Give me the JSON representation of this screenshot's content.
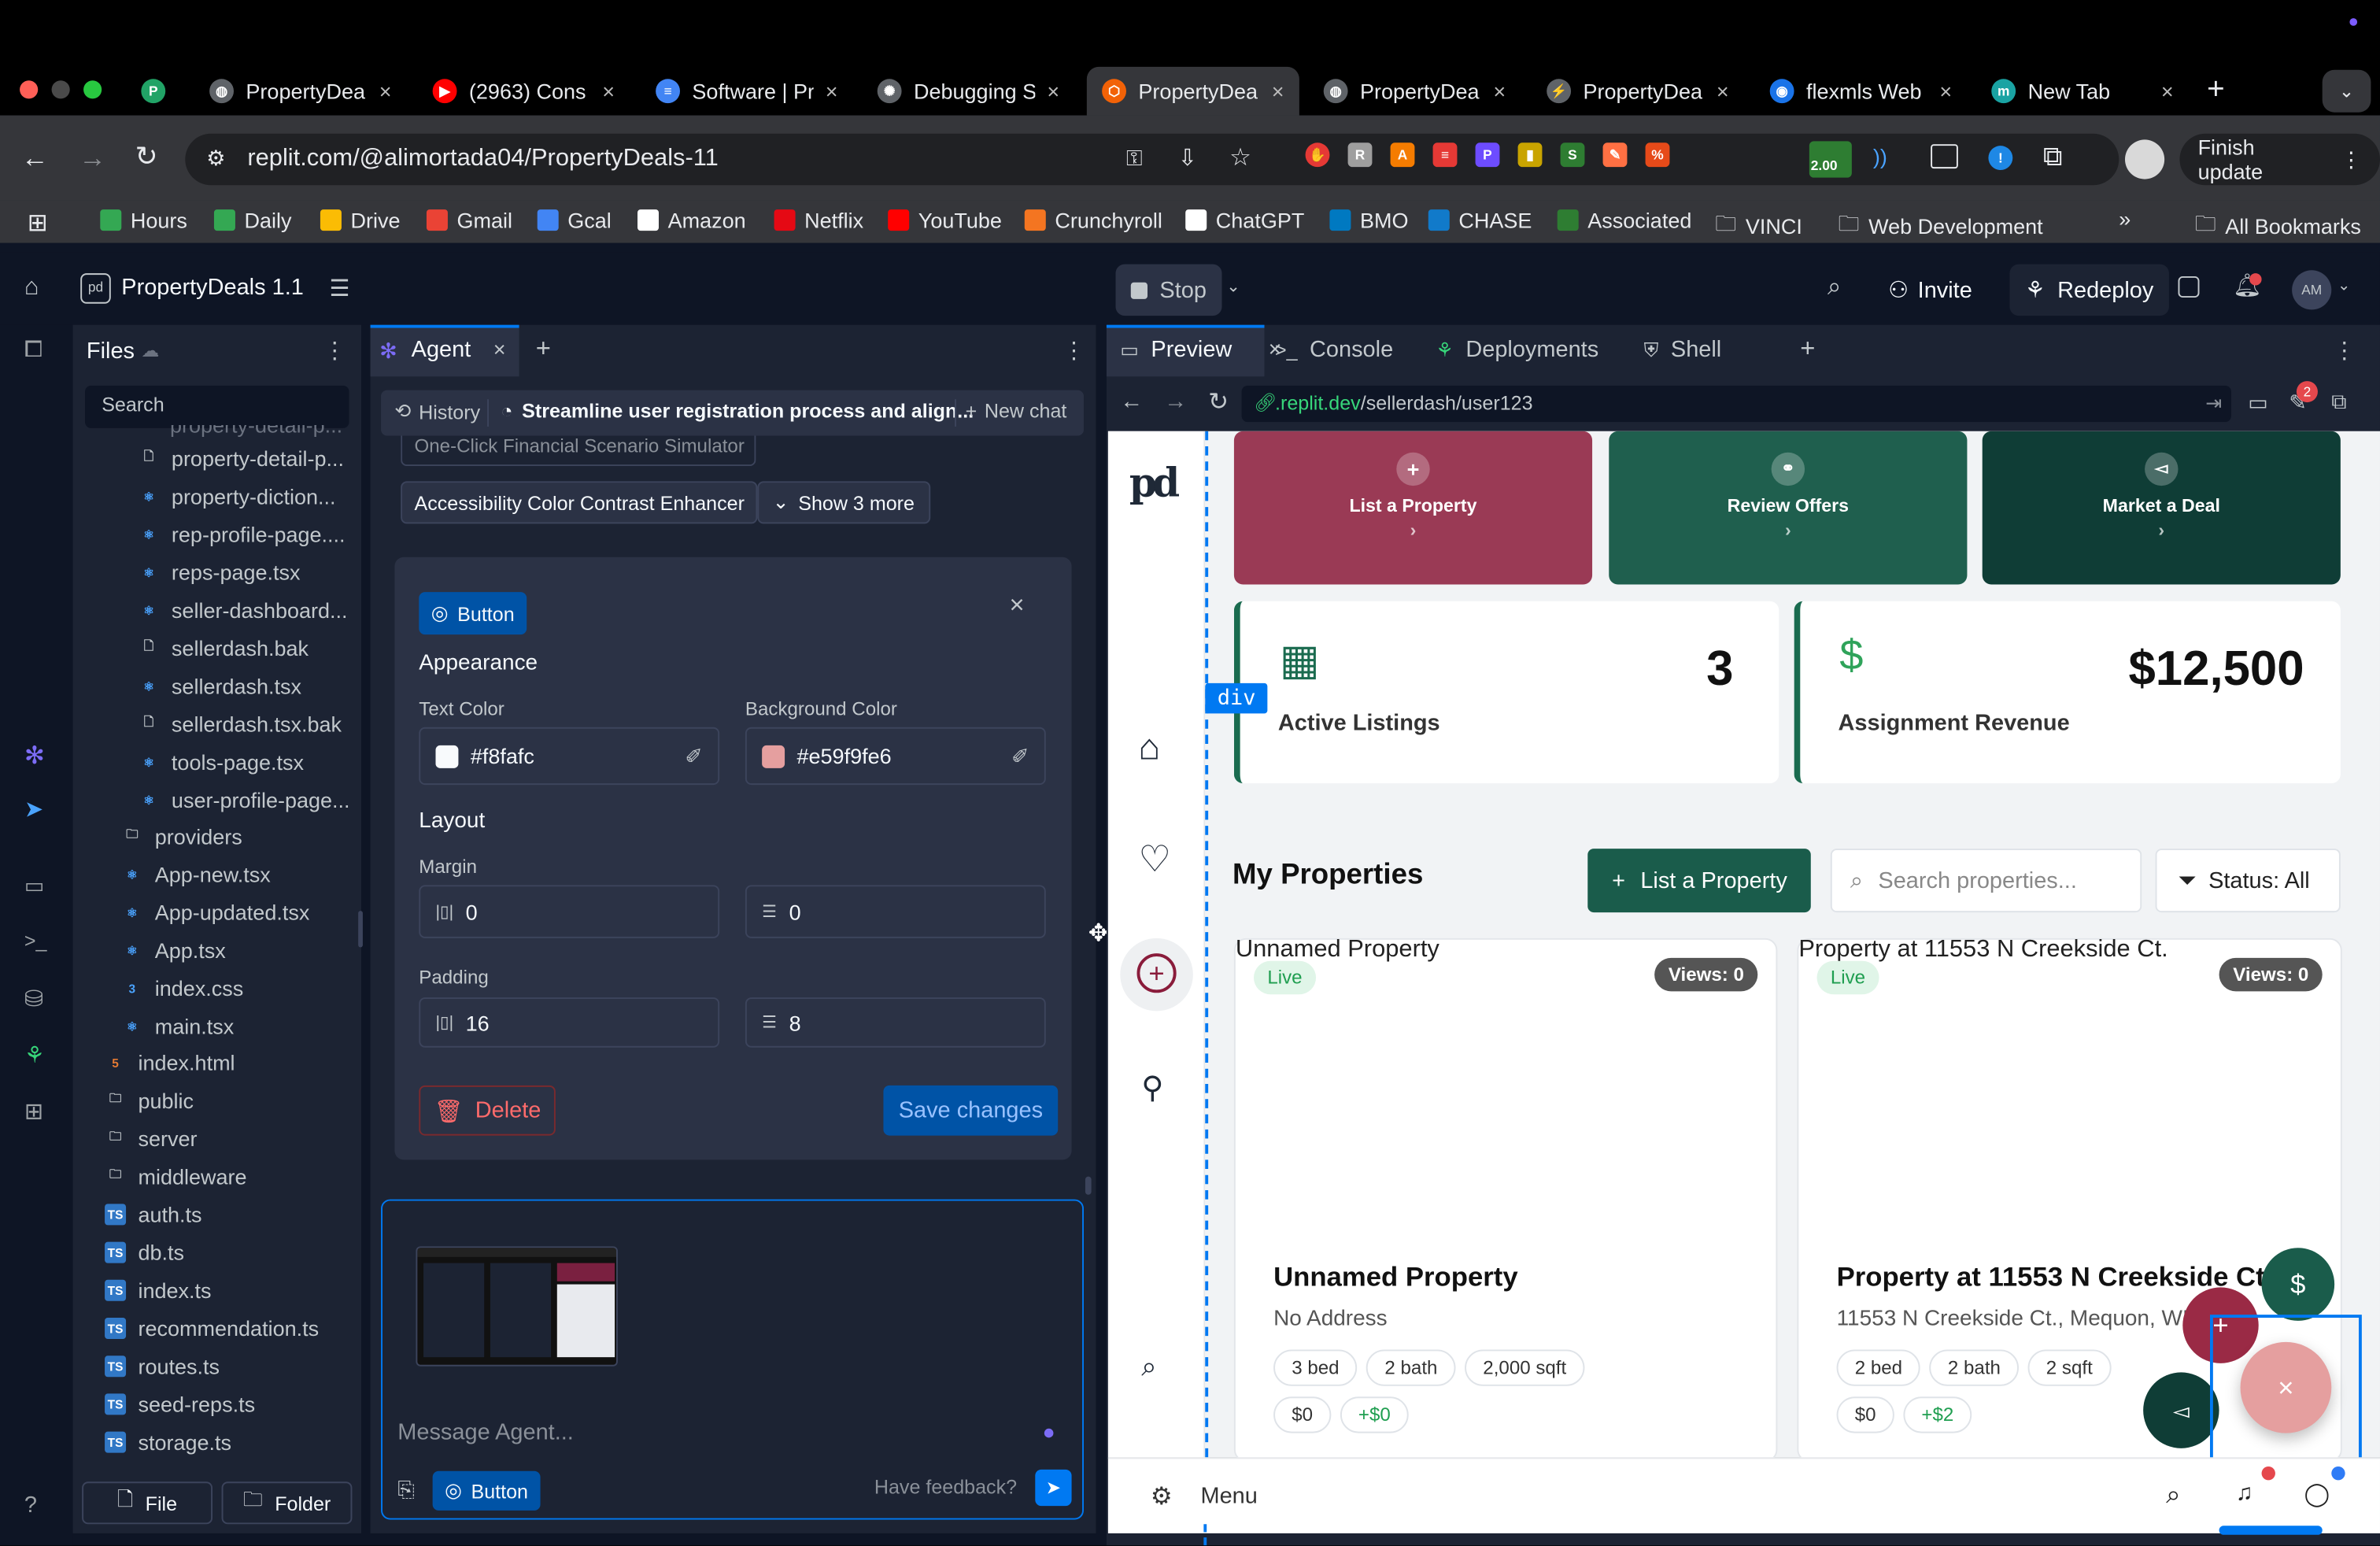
{
  "browser": {
    "tabs": [
      {
        "title": "PropertyDea",
        "icon": "globe-icon"
      },
      {
        "title": "(2963) Cons",
        "icon": "youtube-icon"
      },
      {
        "title": "Software | Pr",
        "icon": "docs-icon"
      },
      {
        "title": "Debugging S",
        "icon": "openai-icon"
      },
      {
        "title": "PropertyDea",
        "icon": "replit-icon"
      },
      {
        "title": "PropertyDea",
        "icon": "globe-icon"
      },
      {
        "title": "PropertyDea",
        "icon": "bolt-icon"
      },
      {
        "title": "flexmls Web",
        "icon": "flexmls-icon"
      },
      {
        "title": "New Tab",
        "icon": "m-icon"
      }
    ],
    "url": "replit.com/@alimortada04/PropertyDeals-11",
    "finish_update": "Finish update",
    "ext_badge": "2.00",
    "bookmarks": [
      "Hours",
      "Daily",
      "Drive",
      "Gmail",
      "Gcal",
      "Amazon",
      "Netflix",
      "YouTube",
      "Crunchyroll",
      "ChatGPT",
      "BMO",
      "CHASE",
      "Associated",
      "VINCI",
      "Web Development"
    ],
    "all_bookmarks": "All Bookmarks"
  },
  "replit": {
    "project": "PropertyDeals 1.1",
    "stop": "Stop",
    "invite": "Invite",
    "redeploy": "Redeploy",
    "avatar": "AM"
  },
  "files": {
    "title": "Files",
    "search": "Search",
    "cut_top": "property-detail-p...",
    "items": [
      {
        "name": "property-detail-p...",
        "type": "file"
      },
      {
        "name": "property-diction...",
        "type": "react"
      },
      {
        "name": "rep-profile-page....",
        "type": "react"
      },
      {
        "name": "reps-page.tsx",
        "type": "react"
      },
      {
        "name": "seller-dashboard...",
        "type": "react"
      },
      {
        "name": "sellerdash.bak",
        "type": "file"
      },
      {
        "name": "sellerdash.tsx",
        "type": "react"
      },
      {
        "name": "sellerdash.tsx.bak",
        "type": "file"
      },
      {
        "name": "tools-page.tsx",
        "type": "react"
      },
      {
        "name": "user-profile-page...",
        "type": "react"
      }
    ],
    "items2": [
      {
        "name": "providers",
        "type": "folder"
      },
      {
        "name": "App-new.tsx",
        "type": "react"
      },
      {
        "name": "App-updated.tsx",
        "type": "react"
      },
      {
        "name": "App.tsx",
        "type": "react"
      },
      {
        "name": "index.css",
        "type": "css"
      },
      {
        "name": "main.tsx",
        "type": "react"
      }
    ],
    "items3": [
      {
        "name": "index.html",
        "type": "html"
      },
      {
        "name": "public",
        "type": "folder"
      },
      {
        "name": "server",
        "type": "folder"
      }
    ],
    "items4": [
      {
        "name": "middleware",
        "type": "folder"
      },
      {
        "name": "auth.ts",
        "type": "ts"
      },
      {
        "name": "db.ts",
        "type": "ts"
      },
      {
        "name": "index.ts",
        "type": "ts"
      },
      {
        "name": "recommendation.ts",
        "type": "ts"
      },
      {
        "name": "routes.ts",
        "type": "ts"
      },
      {
        "name": "seed-reps.ts",
        "type": "ts"
      },
      {
        "name": "storage.ts",
        "type": "ts"
      }
    ],
    "new_file": "File",
    "new_folder": "Folder"
  },
  "agent": {
    "tab": "Agent",
    "history": "History",
    "thread": "Streamline user registration process and align...",
    "new_chat": "New chat",
    "suggestion_cut": "One-Click Financial Scenario Simulator",
    "suggestion": "Accessibility Color Contrast Enhancer",
    "show_more": "Show 3 more",
    "editor": {
      "badge": "Button",
      "appearance": "Appearance",
      "text_color_label": "Text Color",
      "text_color": "#f8fafc",
      "bg_color_label": "Background Color",
      "bg_color": "#e59f9fe6",
      "layout": "Layout",
      "margin_label": "Margin",
      "margin_x": "0",
      "margin_y": "0",
      "padding_label": "Padding",
      "padding_x": "16",
      "padding_y": "8",
      "delete": "Delete",
      "save": "Save changes"
    },
    "input_placeholder": "Message Agent...",
    "attach_badge": "Button",
    "feedback": "Have feedback?"
  },
  "preview": {
    "tabs": [
      "Preview",
      "Console",
      "Deployments",
      "Shell"
    ],
    "url_domain": ".replit.dev",
    "url_path": "/sellerdash/user123",
    "badge": "2",
    "div_tag": "div",
    "app": {
      "logo": "pd",
      "quick": [
        "List a Property",
        "Review Offers",
        "Market a Deal"
      ],
      "stats": [
        {
          "label": "Active Listings",
          "value": "3",
          "icon": "building-icon"
        },
        {
          "label": "Assignment Revenue",
          "value": "$12,500",
          "icon": "dollar-icon"
        }
      ],
      "section": "My Properties",
      "list_btn": "List a Property",
      "search_ph": "Search properties...",
      "status": "Status: All",
      "cards": [
        {
          "img_alt": "Unnamed Property",
          "status": "Live",
          "views": "Views: 0",
          "title": "Unnamed Property",
          "address": "No Address",
          "chips": [
            "3 bed",
            "2 bath",
            "2,000 sqft"
          ],
          "price": "$0",
          "delta": "+$0"
        },
        {
          "img_alt": "Property at 11553 N Creekside Ct.",
          "status": "Live",
          "views": "Views: 0",
          "title": "Property at 11553 N Creekside Ct.",
          "address": "11553 N Creekside Ct., Mequon, WI",
          "chips": [
            "2 bed",
            "2 bath",
            "2 sqft"
          ],
          "price": "$0",
          "delta": "+$2"
        }
      ],
      "menu": "Menu"
    }
  }
}
